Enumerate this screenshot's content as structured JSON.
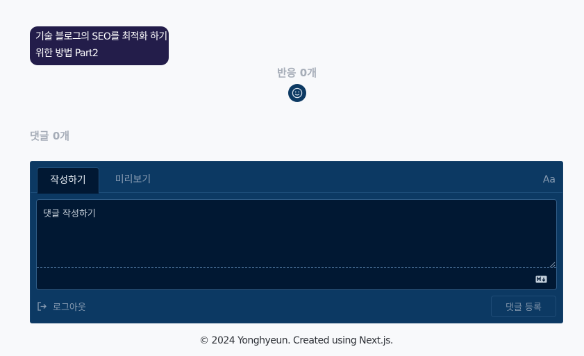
{
  "post": {
    "title_line1": "기술 블로그의 SEO를 최적화 하기",
    "title_line2": "위한 방법 Part2"
  },
  "reactions": {
    "count_label": "반응 0개",
    "icon": "smile-icon"
  },
  "comments": {
    "count_label": "댓글 0개"
  },
  "editor": {
    "tabs": [
      {
        "label": "작성하기",
        "active": true
      },
      {
        "label": "미리보기",
        "active": false
      }
    ],
    "format_label": "Aa",
    "placeholder": "댓글 작성하기",
    "value": "",
    "markdown_icon": "markdown-icon",
    "logout_label": "로그아웃",
    "logout_icon": "sign-out-icon",
    "submit_label": "댓글 등록"
  },
  "footer": {
    "text": "© 2024 Yonghyeun. Created using Next.js."
  },
  "colors": {
    "page_bg": "#f8f9fb",
    "chip_bg": "#231d4a",
    "editor_bg": "#0c3963",
    "textarea_bg": "#011833",
    "muted_text": "#a6adb8"
  }
}
